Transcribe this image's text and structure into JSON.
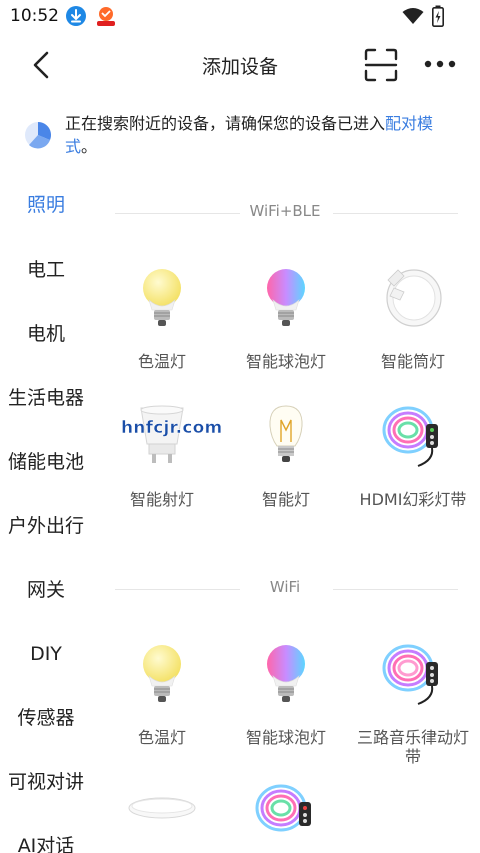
{
  "status_bar": {
    "time": "10:52"
  },
  "nav": {
    "title": "添加设备"
  },
  "notice": {
    "text": "正在搜索附近的设备，请确保您的设备已进入",
    "link": "配对模式",
    "suffix": "。"
  },
  "sidebar": {
    "items": [
      {
        "label": "照明",
        "active": true
      },
      {
        "label": "电工"
      },
      {
        "label": "电机"
      },
      {
        "label": "生活电器"
      },
      {
        "label": "储能电池"
      },
      {
        "label": "户外出行"
      },
      {
        "label": "网关"
      },
      {
        "label": "DIY"
      },
      {
        "label": "传感器"
      },
      {
        "label": "可视对讲"
      },
      {
        "label": "AI对话"
      }
    ]
  },
  "sections": [
    {
      "title": "WiFi+BLE",
      "devices": [
        {
          "label": "色温灯",
          "icon": "bulb-warm-icon"
        },
        {
          "label": "智能球泡灯",
          "icon": "bulb-rgb-icon"
        },
        {
          "label": "智能筒灯",
          "icon": "downlight-icon"
        },
        {
          "label": "智能射灯",
          "icon": "spotlight-icon"
        },
        {
          "label": "智能灯",
          "icon": "filament-bulb-icon"
        },
        {
          "label": "HDMI幻彩灯带",
          "icon": "led-strip-icon"
        }
      ]
    },
    {
      "title": "WiFi",
      "devices": [
        {
          "label": "色温灯",
          "icon": "bulb-warm-icon"
        },
        {
          "label": "智能球泡灯",
          "icon": "bulb-rgb-icon"
        },
        {
          "label": "三路音乐律动灯带",
          "icon": "led-strip-icon"
        },
        {
          "label": "",
          "icon": "ceiling-light-icon"
        },
        {
          "label": "",
          "icon": "led-strip-icon"
        }
      ]
    }
  ],
  "watermark": "hnfcjr.com",
  "colors": {
    "accent": "#3a7de0",
    "text": "#222222",
    "muted": "#888888"
  }
}
